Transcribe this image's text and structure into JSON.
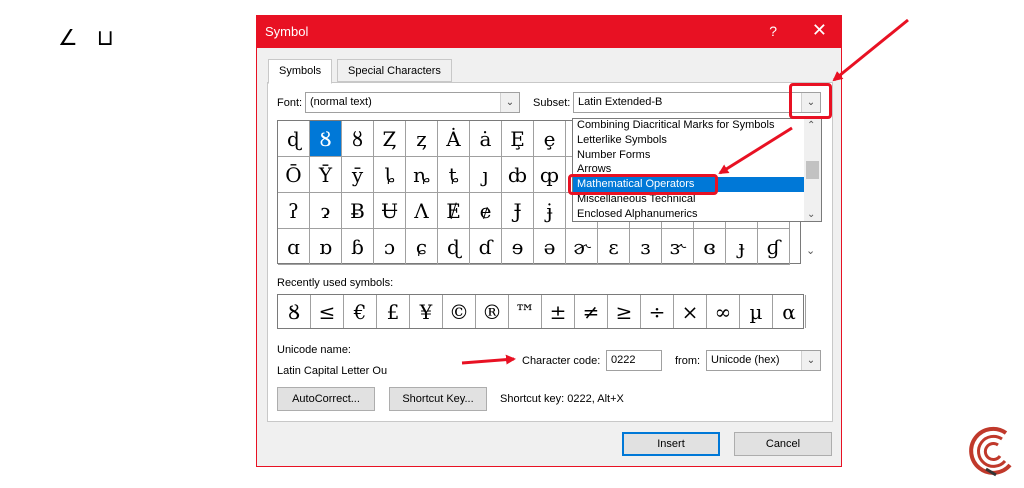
{
  "document_text": "∠ ⊔",
  "dialog": {
    "title": "Symbol",
    "help_glyph": "?",
    "close_glyph": "✕",
    "tabs": [
      {
        "label": "Symbols"
      },
      {
        "label": "Special Characters"
      }
    ],
    "font": {
      "label": "Font:",
      "value": "(normal text)"
    },
    "subset": {
      "label": "Subset:",
      "value": "Latin Extended-B",
      "options": [
        "Combining Diacritical Marks for Symbols",
        "Letterlike Symbols",
        "Number Forms",
        "Arrows",
        "Mathematical Operators",
        "Miscellaneous Technical",
        "Enclosed Alphanumerics"
      ],
      "highlighted": "Mathematical Operators"
    },
    "symbol_grid": [
      [
        "ɖ",
        "Ȣ",
        "ȣ",
        "Ȥ",
        "ȥ",
        "Ȧ",
        "ȧ",
        "Ȩ",
        "ȩ",
        "",
        "",
        "",
        "",
        "",
        "",
        ""
      ],
      [
        "Ō",
        "Ȳ",
        "ȳ",
        "ȴ",
        "ȵ",
        "ȶ",
        "ȷ",
        "ȸ",
        "ȹ",
        "",
        "",
        "",
        "",
        "",
        "",
        ""
      ],
      [
        "ʔ",
        "ɂ",
        "Ƀ",
        "Ʉ",
        "Ʌ",
        "Ɇ",
        "ɇ",
        "Ɉ",
        "ɉ",
        "",
        "",
        "",
        "",
        "",
        "",
        ""
      ],
      [
        "ɑ",
        "ɒ",
        "ɓ",
        "ɔ",
        "ɕ",
        "ɖ",
        "ɗ",
        "ɘ",
        "ə",
        "ɚ",
        "ɛ",
        "ɜ",
        "ɝ",
        "ɞ",
        "ɟ",
        "ɠ"
      ]
    ],
    "selected_symbol": "Ȣ",
    "recent": {
      "label": "Recently used symbols:",
      "symbols": [
        "Ȣ",
        "≤",
        "€",
        "£",
        "¥",
        "©",
        "®",
        "™",
        "±",
        "≠",
        "≥",
        "÷",
        "×",
        "∞",
        "µ",
        "α"
      ]
    },
    "unicode_name": {
      "label": "Unicode name:",
      "value": "Latin Capital Letter Ou"
    },
    "char_code": {
      "label": "Character code:",
      "value": "0222"
    },
    "from": {
      "label": "from:",
      "value": "Unicode (hex)"
    },
    "autocorrect_label": "AutoCorrect...",
    "shortcut_key_button_label": "Shortcut Key...",
    "shortcut_key_text": "Shortcut key: 0222, Alt+X",
    "insert_label": "Insert",
    "cancel_label": "Cancel"
  },
  "colors": {
    "accent_red": "#e81123",
    "selection_blue": "#0078d7"
  },
  "icons": {
    "watermark": "brand-logo-icon"
  }
}
